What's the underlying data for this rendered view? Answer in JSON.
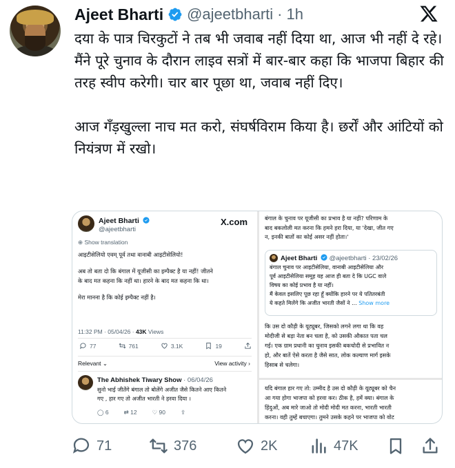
{
  "author": {
    "name": "Ajeet Bharti",
    "handle": "@ajeetbharti",
    "separator": "·",
    "time": "1h"
  },
  "tweet": {
    "paragraphs": [
      "दया के पात्र चिरकुटों ने तब भी जवाब नहीं दिया था, आज भी नहीं दे रहे। मैंने पूरे चुनाव के दौरान लाइव सत्रों में बार-बार कहा कि भाजपा बिहार की तरह स्वीप करेगी। चार बार पूछा था, जवाब नहीं दिए।",
      "आज गँड़खुल्ला नाच मत करो, संघर्षविराम किया है। छर्रों और आंटियों को नियंत्रण में रखो।"
    ]
  },
  "screenshot": {
    "left": {
      "name": "Ajeet Bharti",
      "handle": "@ajeetbharti",
      "site": "X.com",
      "show_translation": "Show translation",
      "lines": [
        "आइटीसेलियो एवम् पूर्व तथा वानाबी आइटीसेलियो!",
        "",
        "अब तो बता दो कि बंगाल में यूजीसी का इम्पैक्ट है या नहीं! जीतने",
        "के बाद मत कहना कि नहीं था। हारने के बाद मत कहना कि था।",
        "",
        "मेरा मानना है कि कोई इम्पैक्ट नहीं है।"
      ],
      "meta_time": "11:32 PM · 05/04/26 · ",
      "meta_views": "43K",
      "meta_views_label": " Views",
      "stats": [
        "77",
        "761",
        "3.1K",
        "19"
      ],
      "relevant": "Relevant",
      "view_activity": "View activity",
      "reply": {
        "name": "The Abhishek Tiwary Show",
        "date": "· 06/04/26",
        "lines": [
          "सुनो भाई जीतेंगे बंगाल तो बोलेंगे अजीत जैसे कितने आए कितने",
          "गए , हार गए तो अजीत भारती ने हरवा दिया ।"
        ],
        "stats": [
          "6",
          "12",
          "90"
        ]
      }
    },
    "right": {
      "top_lines": [
        "बंगाल के चुनाव पर यूजीसी का प्रभाव है या नहीं? परिणाम के",
        "बाद बकलोली मत करना कि हमने हरा दिया, या 'देखा, जीत गए",
        "न, इनकी बातों का कोई असर नहीं होता।'"
      ],
      "quote": {
        "name": "Ajeet Bharti",
        "handle": "@ajeetbharti · 23/02/26",
        "lines": [
          "बंगाल चुनाव पर आइटीसेलिया, वानाबी आइटीसेलिया और",
          "पूर्व आइटीसेलिया समूह यह आज ही बता दे कि UGC वाले",
          "विषय का कोई प्रभाव है या नहीं।",
          "मैं केवल इसलिए पूछ रहा हूँ क्योंकि हारने पर ये पतितरबंती",
          "ये कहते मिलेंगे कि अजीत भारती जैसों ने ..."
        ],
        "show_more": "Show more"
      },
      "mid_lines": [
        "कि उस दो कौड़ी के यूट्यूबर, जिसको लगने लगा था कि वह",
        "मोदीजी से बड़ा नेता बन चला है, को उसकी औकात पता चल",
        "गई। एक ग्राम प्रधानी का चुनाव इसकी बकचोदी से प्रभावित न",
        "हो, और बातें ऐसे करता है जैसे सात, लोक कल्याण मार्ग इसके",
        "हिसाब से चलेगा।"
      ],
      "bottom_lines": [
        "यदि बंगाल हार गए तो: उम्मीद है उस दो कौड़ी के यूट्यूबर को चैन",
        "आ गया होगा भाजपा को हरवा कर। ठीक है, हमें क्या। बंगाल के",
        "हिंदुओं, अब मारे जाओ तो मोदी मोदी मत करना, भारती भारती",
        "करना। वही तुम्हें बचाएगा। तुमने उसके कहने पर भाजपा को वोट"
      ]
    }
  },
  "actions": {
    "replies": "71",
    "reposts": "376",
    "likes": "2K",
    "views": "47K"
  },
  "icons": [
    "verified-badge-icon",
    "x-logo-icon",
    "reply-icon",
    "repost-icon",
    "like-icon",
    "views-icon",
    "bookmark-icon",
    "share-icon"
  ],
  "colors": {
    "accent": "#1d9bf0",
    "muted": "#536471",
    "text": "#0f1419"
  }
}
